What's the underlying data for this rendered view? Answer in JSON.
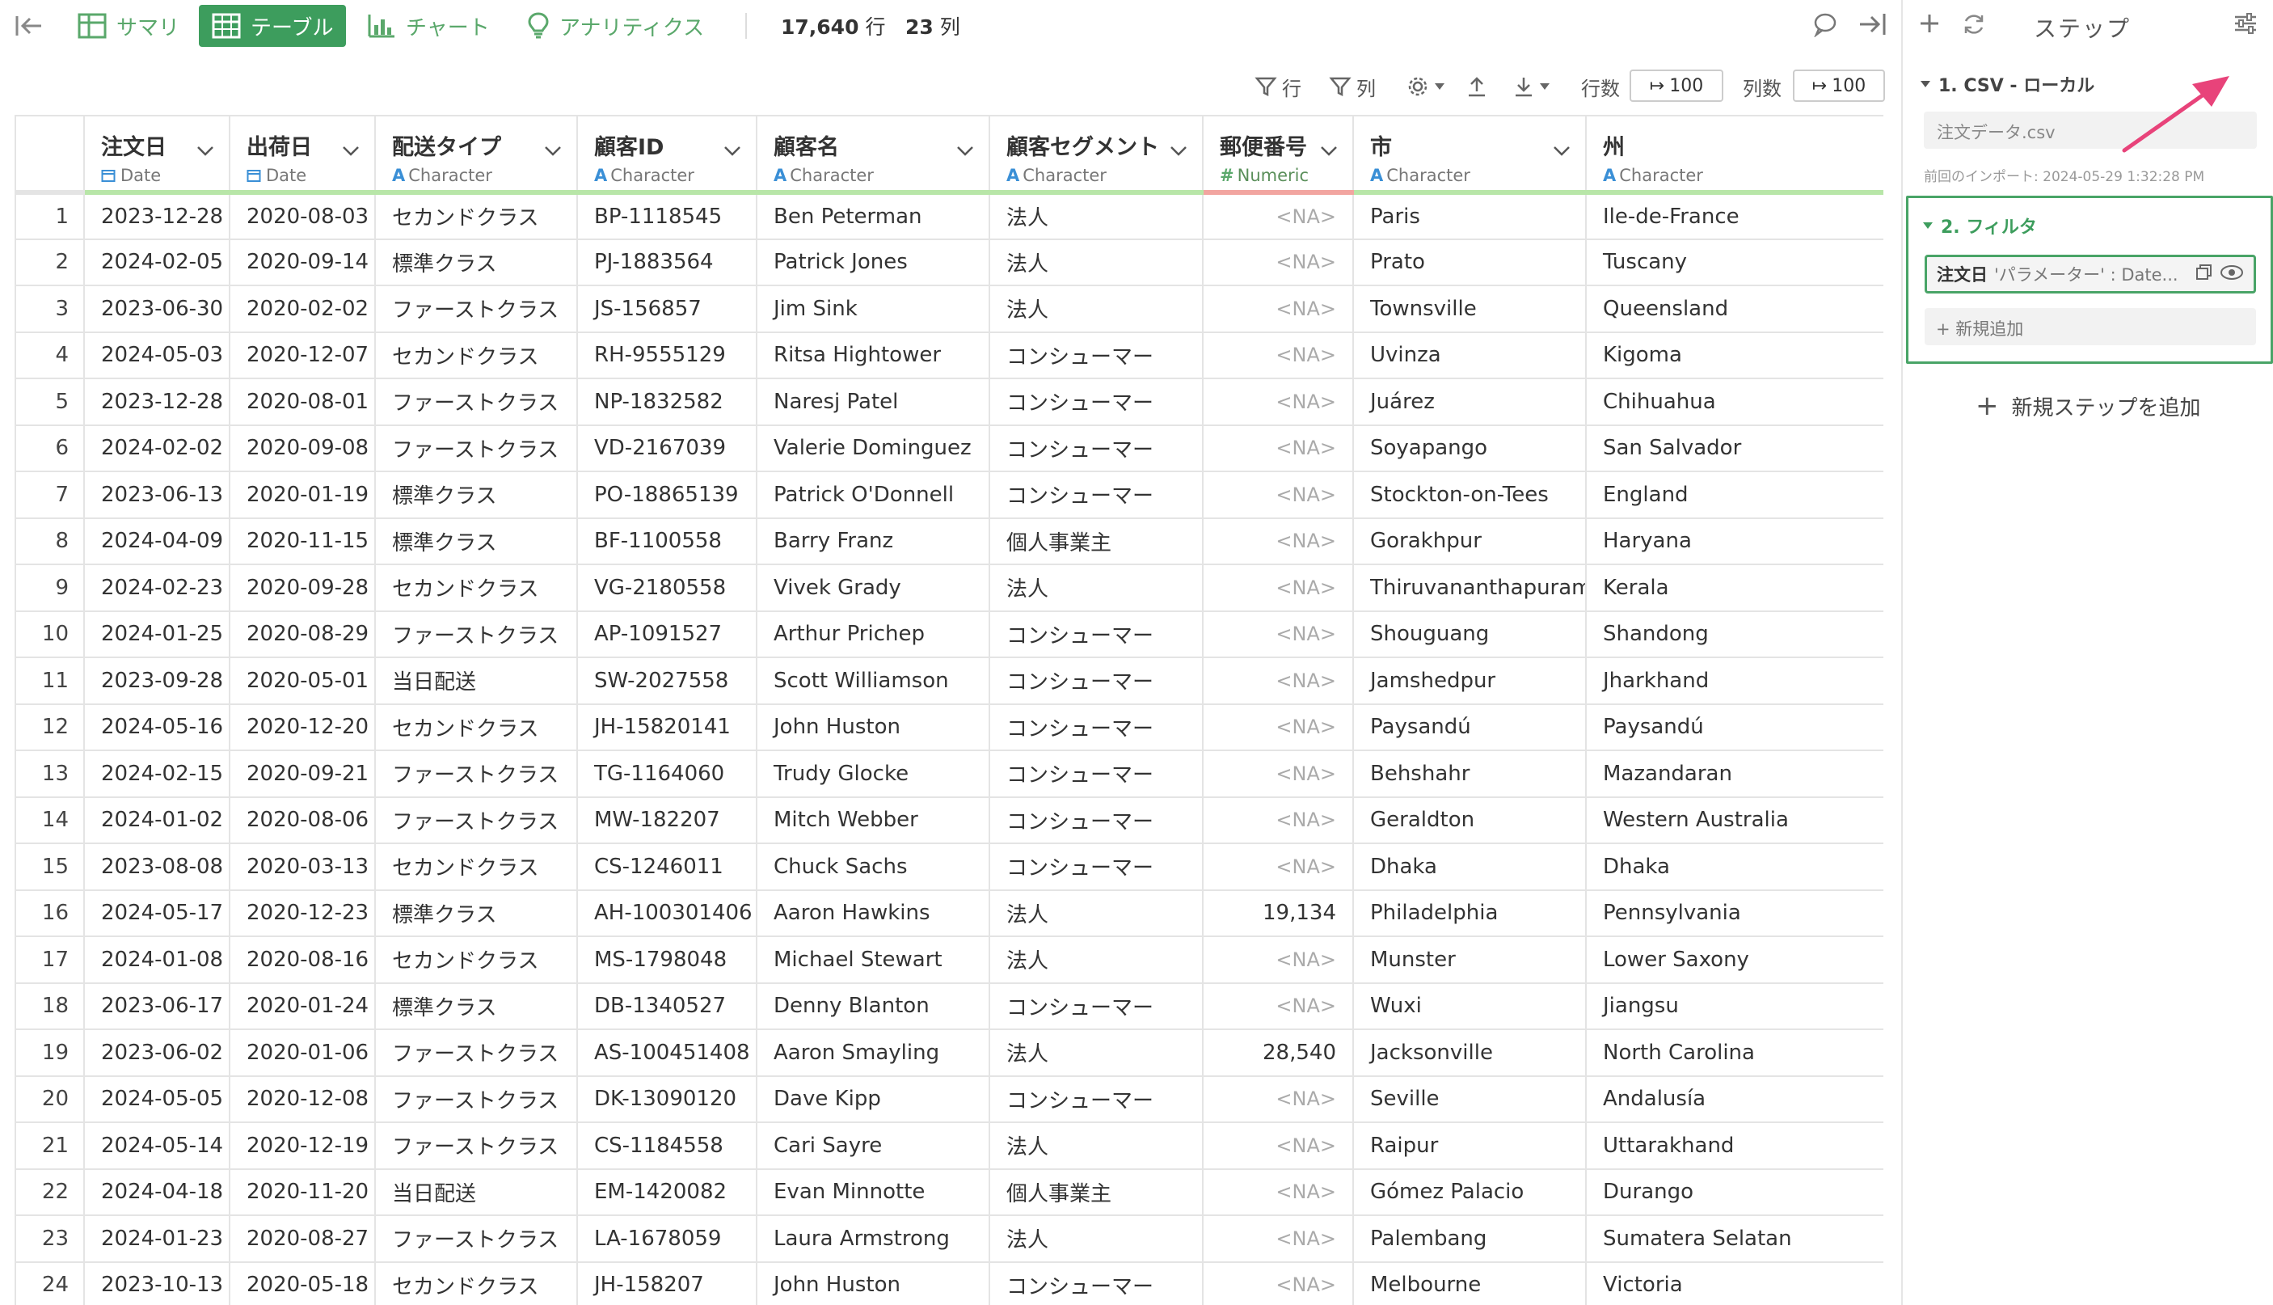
{
  "toolbar": {
    "tabs": [
      {
        "label": "サマリ"
      },
      {
        "label": "テーブル"
      },
      {
        "label": "チャート"
      },
      {
        "label": "アナリティクス"
      }
    ],
    "row_count": "17,640",
    "row_unit": "行",
    "col_count": "23",
    "col_unit": "列"
  },
  "subbar": {
    "row_filter_label": "行",
    "col_filter_label": "列",
    "rows_label": "行数",
    "rows_value": "100",
    "cols_label": "列数",
    "cols_value": "100"
  },
  "table": {
    "columns": [
      {
        "name": "注文日",
        "type": "Date"
      },
      {
        "name": "出荷日",
        "type": "Date"
      },
      {
        "name": "配送タイプ",
        "type": "Character"
      },
      {
        "name": "顧客ID",
        "type": "Character"
      },
      {
        "name": "顧客名",
        "type": "Character"
      },
      {
        "name": "顧客セグメント",
        "type": "Character"
      },
      {
        "name": "郵便番号",
        "type": "Numeric"
      },
      {
        "name": "市",
        "type": "Character"
      },
      {
        "name": "州",
        "type": "Character"
      }
    ],
    "rows": [
      [
        "1",
        "2023-12-28",
        "2020-08-03",
        "セカンドクラス",
        "BP-1118545",
        "Ben Peterman",
        "法人",
        "<NA>",
        "Paris",
        "Ile-de-France"
      ],
      [
        "2",
        "2024-02-05",
        "2020-09-14",
        "標準クラス",
        "PJ-1883564",
        "Patrick Jones",
        "法人",
        "<NA>",
        "Prato",
        "Tuscany"
      ],
      [
        "3",
        "2023-06-30",
        "2020-02-02",
        "ファーストクラス",
        "JS-156857",
        "Jim Sink",
        "法人",
        "<NA>",
        "Townsville",
        "Queensland"
      ],
      [
        "4",
        "2024-05-03",
        "2020-12-07",
        "セカンドクラス",
        "RH-9555129",
        "Ritsa Hightower",
        "コンシューマー",
        "<NA>",
        "Uvinza",
        "Kigoma"
      ],
      [
        "5",
        "2023-12-28",
        "2020-08-01",
        "ファーストクラス",
        "NP-1832582",
        "Naresj Patel",
        "コンシューマー",
        "<NA>",
        "Juárez",
        "Chihuahua"
      ],
      [
        "6",
        "2024-02-02",
        "2020-09-08",
        "ファーストクラス",
        "VD-2167039",
        "Valerie Dominguez",
        "コンシューマー",
        "<NA>",
        "Soyapango",
        "San Salvador"
      ],
      [
        "7",
        "2023-06-13",
        "2020-01-19",
        "標準クラス",
        "PO-18865139",
        "Patrick O'Donnell",
        "コンシューマー",
        "<NA>",
        "Stockton-on-Tees",
        "England"
      ],
      [
        "8",
        "2024-04-09",
        "2020-11-15",
        "標準クラス",
        "BF-1100558",
        "Barry Franz",
        "個人事業主",
        "<NA>",
        "Gorakhpur",
        "Haryana"
      ],
      [
        "9",
        "2024-02-23",
        "2020-09-28",
        "セカンドクラス",
        "VG-2180558",
        "Vivek Grady",
        "法人",
        "<NA>",
        "Thiruvananthapuram",
        "Kerala"
      ],
      [
        "10",
        "2024-01-25",
        "2020-08-29",
        "ファーストクラス",
        "AP-1091527",
        "Arthur Prichep",
        "コンシューマー",
        "<NA>",
        "Shouguang",
        "Shandong"
      ],
      [
        "11",
        "2023-09-28",
        "2020-05-01",
        "当日配送",
        "SW-2027558",
        "Scott Williamson",
        "コンシューマー",
        "<NA>",
        "Jamshedpur",
        "Jharkhand"
      ],
      [
        "12",
        "2024-05-16",
        "2020-12-20",
        "セカンドクラス",
        "JH-15820141",
        "John Huston",
        "コンシューマー",
        "<NA>",
        "Paysandú",
        "Paysandú"
      ],
      [
        "13",
        "2024-02-15",
        "2020-09-21",
        "ファーストクラス",
        "TG-1164060",
        "Trudy Glocke",
        "コンシューマー",
        "<NA>",
        "Behshahr",
        "Mazandaran"
      ],
      [
        "14",
        "2024-01-02",
        "2020-08-06",
        "ファーストクラス",
        "MW-182207",
        "Mitch Webber",
        "コンシューマー",
        "<NA>",
        "Geraldton",
        "Western Australia"
      ],
      [
        "15",
        "2023-08-08",
        "2020-03-13",
        "セカンドクラス",
        "CS-1246011",
        "Chuck Sachs",
        "コンシューマー",
        "<NA>",
        "Dhaka",
        "Dhaka"
      ],
      [
        "16",
        "2024-05-17",
        "2020-12-23",
        "標準クラス",
        "AH-100301406",
        "Aaron Hawkins",
        "法人",
        "19,134",
        "Philadelphia",
        "Pennsylvania"
      ],
      [
        "17",
        "2024-01-08",
        "2020-08-16",
        "セカンドクラス",
        "MS-1798048",
        "Michael Stewart",
        "法人",
        "<NA>",
        "Munster",
        "Lower Saxony"
      ],
      [
        "18",
        "2023-06-17",
        "2020-01-24",
        "標準クラス",
        "DB-1340527",
        "Denny Blanton",
        "コンシューマー",
        "<NA>",
        "Wuxi",
        "Jiangsu"
      ],
      [
        "19",
        "2023-06-02",
        "2020-01-06",
        "ファーストクラス",
        "AS-100451408",
        "Aaron Smayling",
        "法人",
        "28,540",
        "Jacksonville",
        "North Carolina"
      ],
      [
        "20",
        "2024-05-05",
        "2020-12-08",
        "ファーストクラス",
        "DK-13090120",
        "Dave Kipp",
        "コンシューマー",
        "<NA>",
        "Seville",
        "Andalusía"
      ],
      [
        "21",
        "2024-05-14",
        "2020-12-19",
        "ファーストクラス",
        "CS-1184558",
        "Cari Sayre",
        "法人",
        "<NA>",
        "Raipur",
        "Uttarakhand"
      ],
      [
        "22",
        "2024-04-18",
        "2020-11-20",
        "当日配送",
        "EM-1420082",
        "Evan Minnotte",
        "個人事業主",
        "<NA>",
        "Gómez Palacio",
        "Durango"
      ],
      [
        "23",
        "2024-01-23",
        "2020-08-27",
        "ファーストクラス",
        "LA-1678059",
        "Laura Armstrong",
        "法人",
        "<NA>",
        "Palembang",
        "Sumatera Selatan"
      ],
      [
        "24",
        "2023-10-13",
        "2020-05-18",
        "セカンドクラス",
        "JH-158207",
        "John Huston",
        "コンシューマー",
        "<NA>",
        "Melbourne",
        "Victoria"
      ]
    ]
  },
  "steps_panel": {
    "title": "ステップ",
    "step1": {
      "label": "1. CSV - ローカル",
      "file": "注文データ.csv",
      "last_import": "前回のインポート: 2024-05-29 1:32:28 PM"
    },
    "step2": {
      "label": "2. フィルタ",
      "filter_key": "注文日",
      "filter_value": "'パラメーター' : Date...",
      "add_new": "+ 新規追加"
    },
    "add_step": "新規ステップを追加"
  },
  "colors": {
    "accent_green": "#3d9d5d",
    "date_icon_blue": "#3a8fd6",
    "character_bar": "#b8e6a8",
    "numeric_bar": "#f2a5a0",
    "annotation_arrow": "#e8437a"
  }
}
